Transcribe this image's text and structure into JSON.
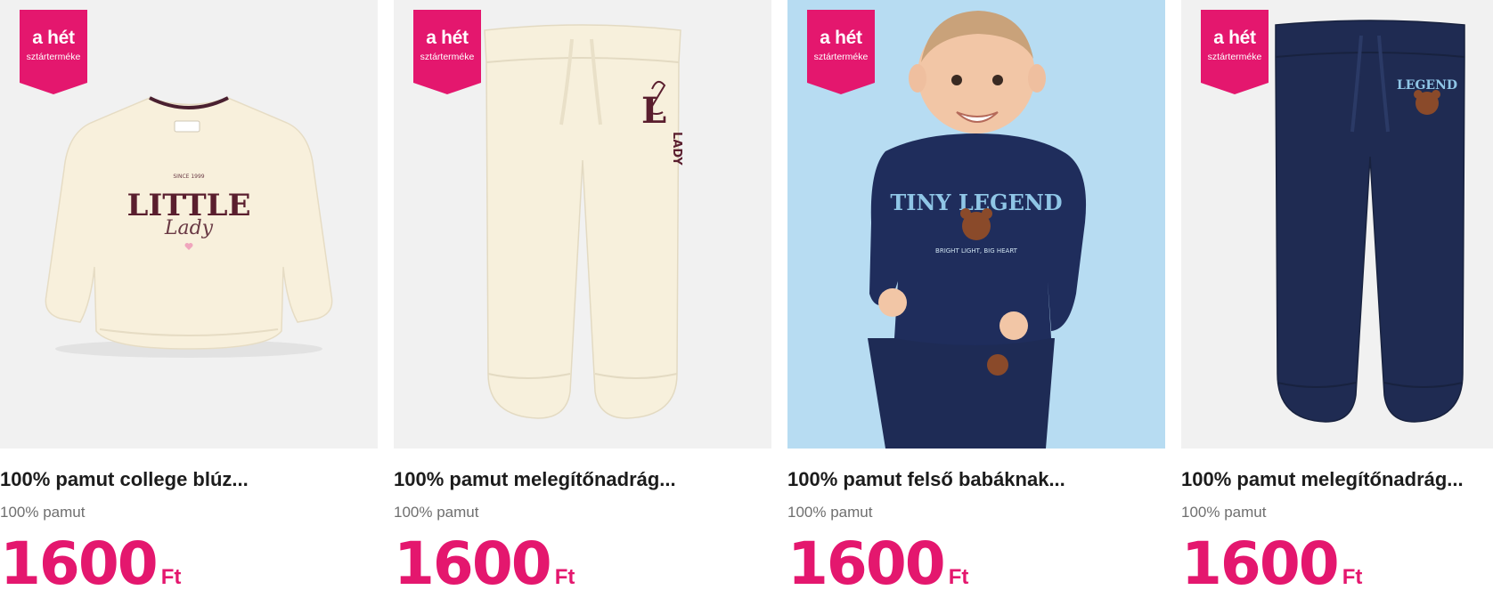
{
  "badge": {
    "line1": "a hét",
    "line2": "sztárterméke",
    "color": "#e4176e"
  },
  "products": [
    {
      "name": "100% pamut college blúz...",
      "material": "100% pamut",
      "price": "1600",
      "currency": "Ft",
      "image_print": "LITTLE",
      "image_script": "Lady"
    },
    {
      "name": "100% pamut melegítőnadrág...",
      "material": "100% pamut",
      "price": "1600",
      "currency": "Ft",
      "image_letter": "L",
      "image_print": "LADY"
    },
    {
      "name": "100% pamut felső babáknak...",
      "material": "100% pamut",
      "price": "1600",
      "currency": "Ft",
      "image_print": "TINY LEGEND",
      "image_sub": "BRIGHT LIGHT, BIG HEART"
    },
    {
      "name": "100% pamut melegítőnadrág...",
      "material": "100% pamut",
      "price": "1600",
      "currency": "Ft",
      "image_print": "LEGEND"
    }
  ],
  "colors": {
    "price": "#e4176e",
    "image_bg": "#f1f1f1",
    "image_bg_photo": "#b7dcf2"
  }
}
